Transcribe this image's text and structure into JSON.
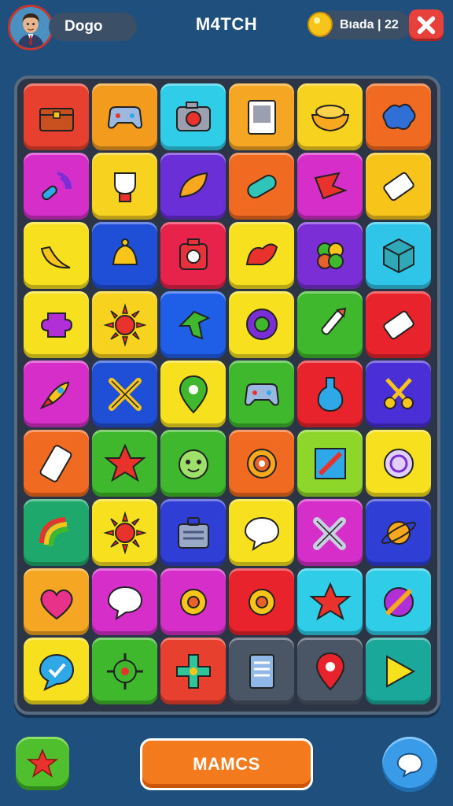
{
  "header": {
    "player_name": "Dogo",
    "title": "M4TCH",
    "currency_label": "Bıada | 22",
    "colors": {
      "close": "#e8403b",
      "coin": "#f7c51a"
    }
  },
  "board": {
    "rows": [
      [
        {
          "color": "#e8402e",
          "icon": "chest-icon"
        },
        {
          "color": "#f29b1c",
          "icon": "gamepad-icon"
        },
        {
          "color": "#2fcde8",
          "icon": "camera-icon"
        },
        {
          "color": "#f5a623",
          "icon": "photo-frame-icon"
        },
        {
          "color": "#f7d21e",
          "icon": "bowl-icon"
        },
        {
          "color": "#f06a21",
          "icon": "splash-icon"
        }
      ],
      [
        {
          "color": "#d62fc9",
          "icon": "microphone-icon"
        },
        {
          "color": "#f7d21e",
          "icon": "trophy-icon"
        },
        {
          "color": "#6a2fd6",
          "icon": "leaf-icon"
        },
        {
          "color": "#f06a21",
          "icon": "capsule-icon"
        },
        {
          "color": "#d62fc9",
          "icon": "arrow-flag-icon"
        },
        {
          "color": "#f7c51a",
          "icon": "battery-icon"
        }
      ],
      [
        {
          "color": "#f7e11e",
          "icon": "banana-icon"
        },
        {
          "color": "#1f4fd6",
          "icon": "bell-icon"
        },
        {
          "color": "#e8234b",
          "icon": "robot-icon"
        },
        {
          "color": "#f7e11e",
          "icon": "wing-icon"
        },
        {
          "color": "#7a2fd6",
          "icon": "clover-icon"
        },
        {
          "color": "#2fc5e8",
          "icon": "cube-icon"
        }
      ],
      [
        {
          "color": "#f7e11e",
          "icon": "puzzle-icon"
        },
        {
          "color": "#f7d21e",
          "icon": "sun-icon"
        },
        {
          "color": "#1f5fe8",
          "icon": "arrow-icon"
        },
        {
          "color": "#f7e11e",
          "icon": "chat-swirl-icon"
        },
        {
          "color": "#3fb82e",
          "icon": "brush-icon"
        },
        {
          "color": "#e8232b",
          "icon": "battery-icon"
        }
      ],
      [
        {
          "color": "#d62fc9",
          "icon": "rocket-icon"
        },
        {
          "color": "#1f4fd6",
          "icon": "cross-tools-icon"
        },
        {
          "color": "#f7e11e",
          "icon": "location-pin-icon"
        },
        {
          "color": "#3fb82e",
          "icon": "gamepad-icon"
        },
        {
          "color": "#e8232b",
          "icon": "potion-icon"
        },
        {
          "color": "#4a2fd6",
          "icon": "scissors-icon"
        }
      ],
      [
        {
          "color": "#f06a21",
          "icon": "phone-icon"
        },
        {
          "color": "#3fb82e",
          "icon": "star-icon"
        },
        {
          "color": "#3fb82e",
          "icon": "monster-face-icon"
        },
        {
          "color": "#f06a21",
          "icon": "target-icon"
        },
        {
          "color": "#8ed629",
          "icon": "pencil-icon"
        },
        {
          "color": "#f7e11e",
          "icon": "magnifier-icon"
        }
      ],
      [
        {
          "color": "#1fa86b",
          "icon": "rainbow-icon"
        },
        {
          "color": "#f7e11e",
          "icon": "sun-icon"
        },
        {
          "color": "#2f3fd6",
          "icon": "briefcase-icon"
        },
        {
          "color": "#f7e11e",
          "icon": "speech-bubble-icon"
        },
        {
          "color": "#d62fc9",
          "icon": "hammer-icon"
        },
        {
          "color": "#2f3fd6",
          "icon": "planet-icon"
        }
      ],
      [
        {
          "color": "#f5a623",
          "icon": "heart-icon"
        },
        {
          "color": "#d62fc9",
          "icon": "speech-bubble-icon"
        },
        {
          "color": "#d62fc9",
          "icon": "gear-icon"
        },
        {
          "color": "#e8232b",
          "icon": "gear-icon"
        },
        {
          "color": "#2fcde8",
          "icon": "star-icon"
        },
        {
          "color": "#2fcde8",
          "icon": "pen-icon"
        }
      ],
      [
        {
          "color": "#f7e11e",
          "icon": "chat-check-icon"
        },
        {
          "color": "#3fb82e",
          "icon": "virus-icon"
        },
        {
          "color": "#e8402e",
          "icon": "dpad-icon"
        },
        {
          "color": "#4a5566",
          "icon": "document-icon"
        },
        {
          "color": "#4a5566",
          "icon": "map-pin-icon"
        },
        {
          "color": "#1aa89b",
          "icon": "play-icon"
        }
      ]
    ]
  },
  "footer": {
    "main_button_label": "MAMCS",
    "left_icon": "star-icon",
    "right_icon": "chat-icon"
  }
}
